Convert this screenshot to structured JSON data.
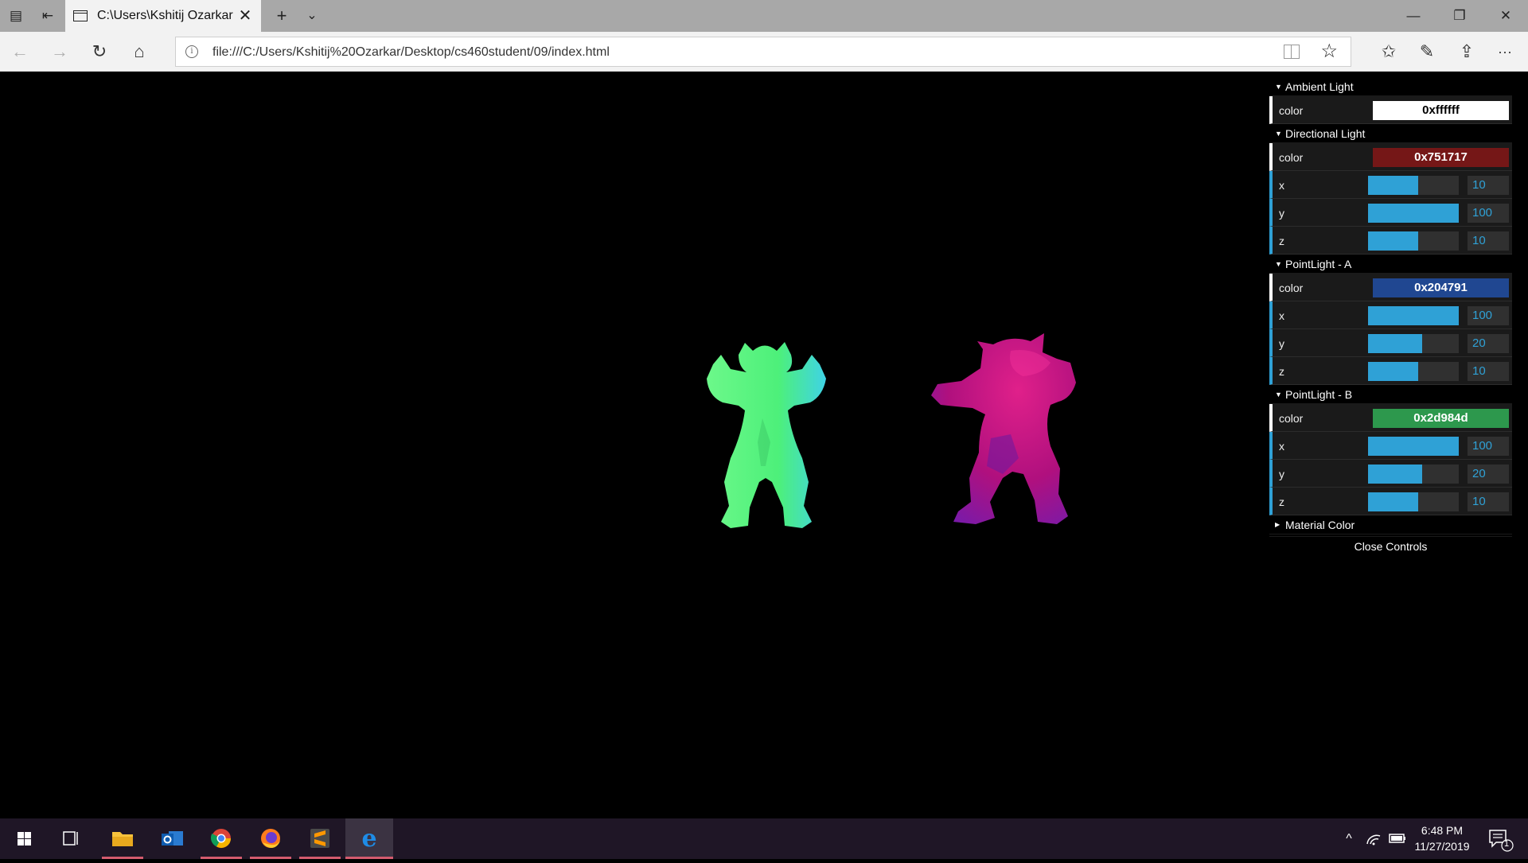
{
  "browser": {
    "tab_title": "C:\\Users\\Kshitij Ozarkar",
    "new_tab_glyph": "+",
    "tab_menu_glyph": "⌄",
    "url": "file:///C:/Users/Kshitij%20Ozarkar/Desktop/cs460student/09/index.html",
    "window_controls": {
      "minimize": "—",
      "maximize": "❐",
      "close": "✕"
    },
    "nav_glyphs": {
      "back": "←",
      "forward": "→",
      "refresh": "↻",
      "home": "⌂",
      "favorites": "☆",
      "hub": "✩",
      "notes": "✎",
      "share": "⇪",
      "more": "···",
      "close_tab": "✕"
    }
  },
  "scene": {
    "models": [
      {
        "name": "green-armadillo",
        "color": "#5cf07a"
      },
      {
        "name": "magenta-armadillo",
        "color": "#c0158a"
      }
    ]
  },
  "gui": {
    "folders": [
      {
        "title": "Ambient Light",
        "open": true,
        "color": {
          "label": "color",
          "value": "0xffffff",
          "hex": "#ffffff",
          "text": "#000000"
        },
        "sliders": []
      },
      {
        "title": "Directional Light",
        "open": true,
        "color": {
          "label": "color",
          "value": "0x751717",
          "hex": "#751717",
          "text": "#ffffff"
        },
        "sliders": [
          {
            "label": "x",
            "value": "10",
            "fraction": 0.55
          },
          {
            "label": "y",
            "value": "100",
            "fraction": 1.0
          },
          {
            "label": "z",
            "value": "10",
            "fraction": 0.55
          }
        ]
      },
      {
        "title": "PointLight - A",
        "open": true,
        "color": {
          "label": "color",
          "value": "0x204791",
          "hex": "#204791",
          "text": "#ffffff"
        },
        "sliders": [
          {
            "label": "x",
            "value": "100",
            "fraction": 1.0
          },
          {
            "label": "y",
            "value": "20",
            "fraction": 0.6
          },
          {
            "label": "z",
            "value": "10",
            "fraction": 0.55
          }
        ]
      },
      {
        "title": "PointLight - B",
        "open": true,
        "color": {
          "label": "color",
          "value": "0x2d984d",
          "hex": "#2d984d",
          "text": "#ffffff"
        },
        "sliders": [
          {
            "label": "x",
            "value": "100",
            "fraction": 1.0
          },
          {
            "label": "y",
            "value": "20",
            "fraction": 0.6
          },
          {
            "label": "z",
            "value": "10",
            "fraction": 0.55
          }
        ]
      }
    ],
    "material_folder": "Material Color",
    "close_label": "Close Controls"
  },
  "taskbar": {
    "time": "6:48 PM",
    "date": "11/27/2019",
    "notification_count": "1",
    "apps": [
      "start",
      "task-view",
      "file-explorer",
      "outlook",
      "chrome",
      "firefox",
      "sublime-text",
      "edge"
    ]
  }
}
